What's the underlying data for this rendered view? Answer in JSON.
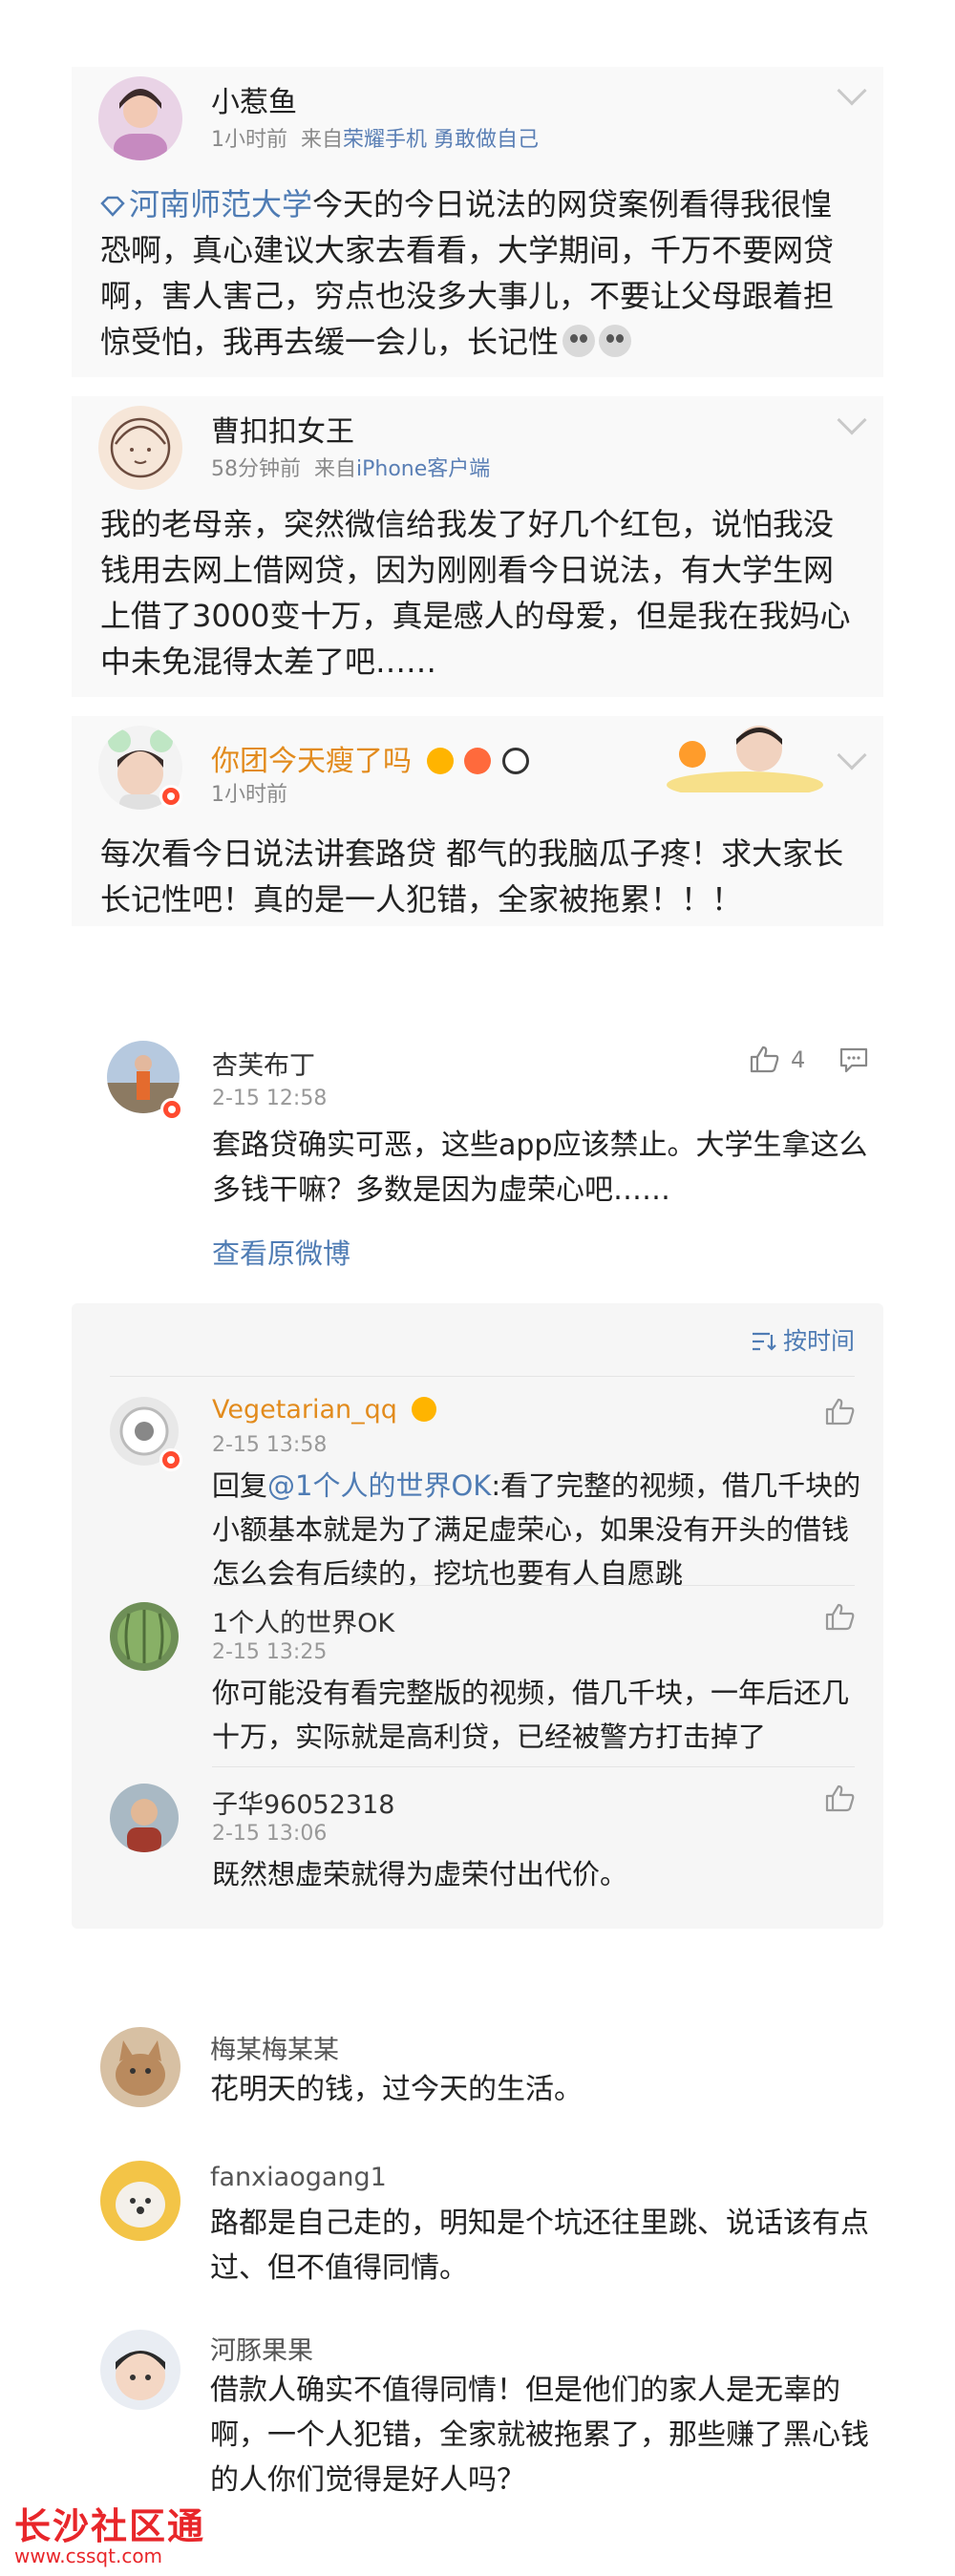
{
  "weibo_posts": [
    {
      "name": "小惹鱼",
      "time": "1小时前",
      "source_prefix": "来自",
      "source": "荣耀手机 勇敢做自己",
      "topic": "河南师范大学",
      "text": "今天的今日说法的网贷案例看得我很惶恐啊，真心建议大家去看看，大学期间，千万不要网贷啊，害人害己，穷点也没多大事儿，不要让父母跟着担惊受怕，我再去缓一会儿，长记性"
    },
    {
      "name": "曹扣扣女王",
      "time": "58分钟前",
      "source_prefix": "来自",
      "source": "iPhone客户端",
      "text": "我的老母亲，突然微信给我发了好几个红包，说怕我没钱用去网上借网贷，因为刚刚看今日说法，有大学生网上借了3000变十万，真是感人的母爱，但是我在我妈心中未免混得太差了吧……"
    },
    {
      "name": "你团今天瘦了吗",
      "time": "1小时前",
      "text": "每次看今日说法讲套路贷 都气的我脑瓜子疼！求大家长长记性吧！真的是一人犯错，全家被拖累！！！"
    }
  ],
  "main_comment": {
    "name": "杏芙布丁",
    "time": "2-15 12:58",
    "likes": "4",
    "text": "套路贷确实可恶，这些app应该禁止。大学生拿这么多钱干嘛？多数是因为虚荣心吧……",
    "view_original": "查看原微博"
  },
  "replies_header": {
    "sort_label": "按时间"
  },
  "replies": [
    {
      "name": "Vegetarian_qq",
      "time": "2-15 13:58",
      "reply_prefix": "回复",
      "mention": "@1个人的世界OK",
      "text": ":看了完整的视频，借几千块的小额基本就是为了满足虚荣心，如果没有开头的借钱怎么会有后续的，挖坑也要有人自愿跳"
    },
    {
      "name": "1个人的世界OK",
      "time": "2-15 13:25",
      "text": "你可能没有看完整版的视频，借几千块，一年后还几十万，实际就是高利贷，已经被警方打击掉了"
    },
    {
      "name": "子华96052318",
      "time": "2-15 13:06",
      "text": "既然想虚荣就得为虚荣付出代价。"
    }
  ],
  "comments": [
    {
      "name": "梅某梅某某",
      "text": "花明天的钱，过今天的生活。"
    },
    {
      "name": "fanxiaogang1",
      "text": "路都是自己走的，明知是个坑还往里跳、说话该有点过、但不值得同情。"
    },
    {
      "name": "河豚果果",
      "text": "借款人确实不值得同情！但是他们的家人是无辜的啊，一个人犯错，全家就被拖累了，那些赚了黑心钱的人你们觉得是好人吗？"
    }
  ],
  "watermark": {
    "title": "长沙社区通",
    "url": "www.cssqt.com"
  },
  "colors": {
    "link": "#4f7cb4",
    "gold_name": "#e28b1d",
    "watermark_red": "#e8262a",
    "badge_red": "#ff4a2f"
  }
}
